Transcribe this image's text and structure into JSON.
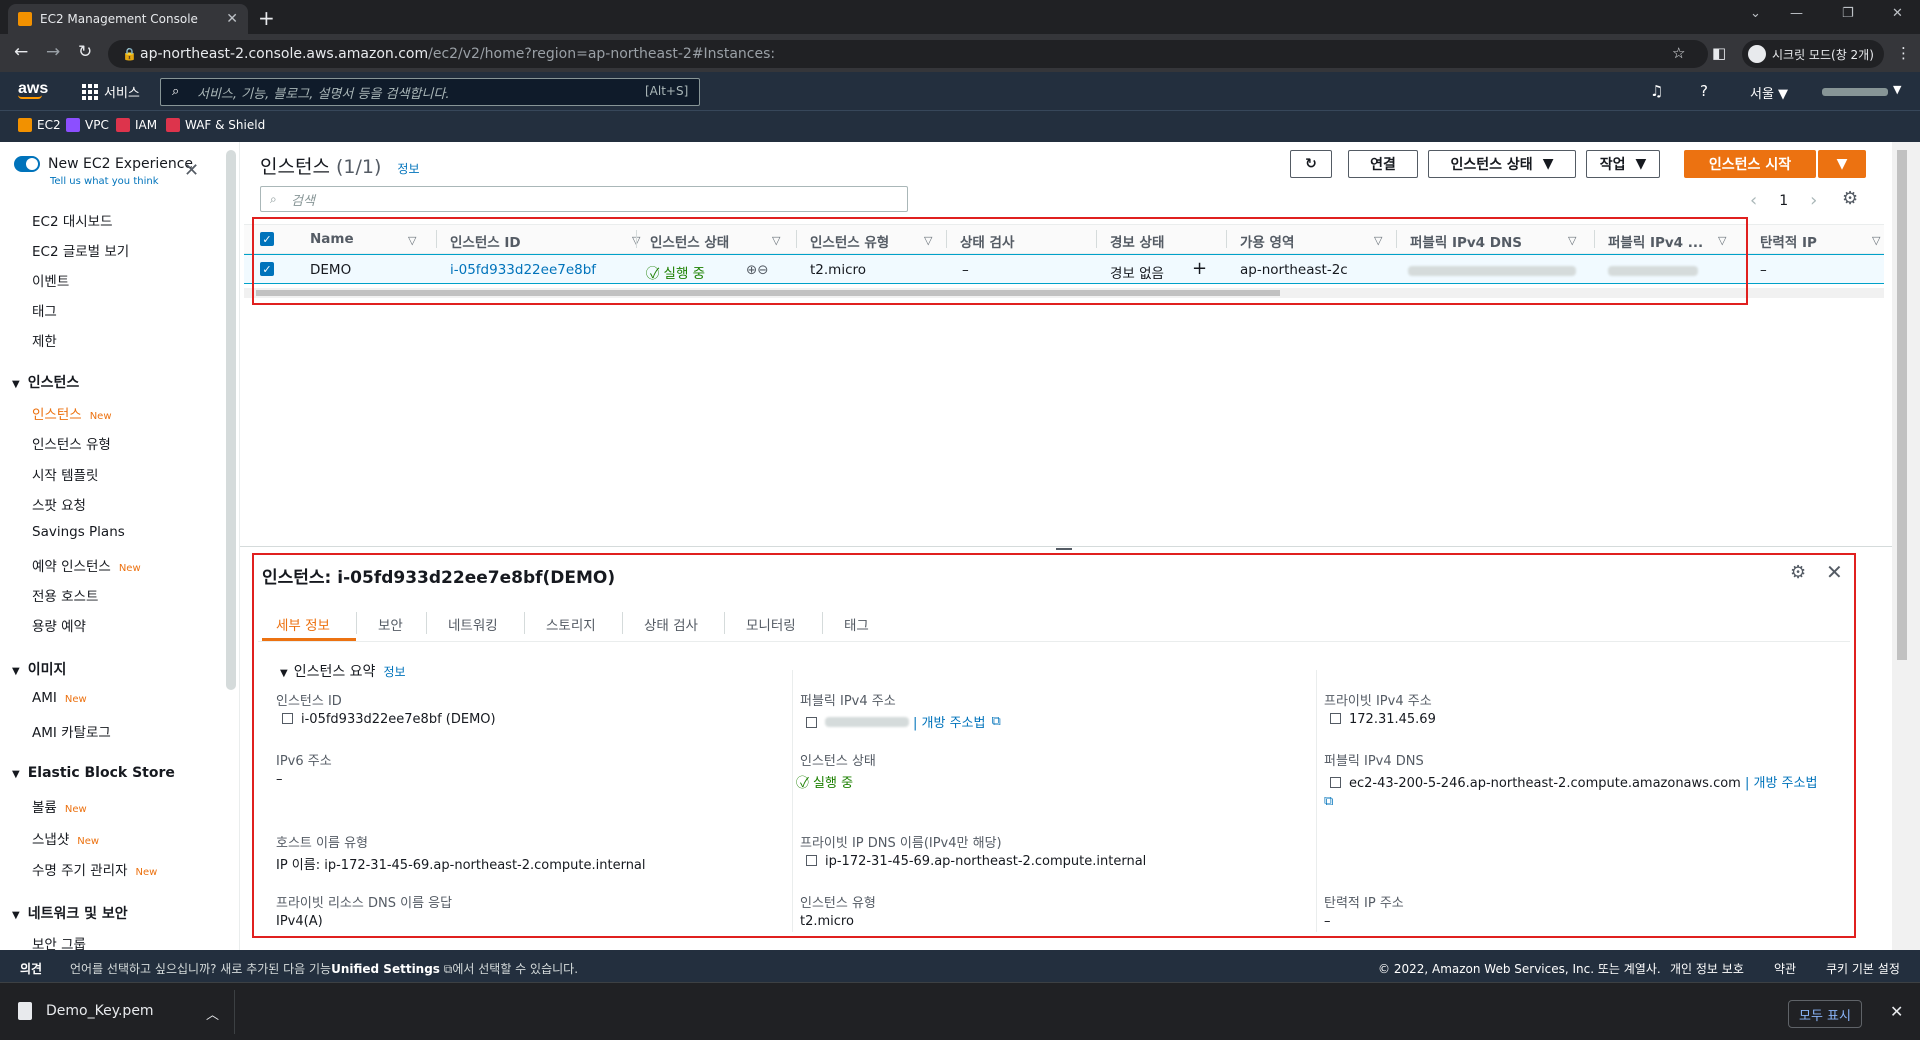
{
  "browser": {
    "tab_title": "EC2 Management Console",
    "url_host": "ap-northeast-2.console.aws.amazon.com",
    "url_path": "/ec2/v2/home?region=ap-northeast-2#Instances:",
    "incognito_label": "시크릿 모드(창 2개)"
  },
  "awsnav": {
    "logo": "aws",
    "services_label": "서비스",
    "search_placeholder": "서비스, 기능, 블로그, 설명서 등을 검색합니다.",
    "search_shortcut": "[Alt+S]",
    "region": "서울 ▼"
  },
  "favorites": [
    {
      "label": "EC2",
      "color": "#f29100"
    },
    {
      "label": "VPC",
      "color": "#8c4fff"
    },
    {
      "label": "IAM",
      "color": "#dd344c"
    },
    {
      "label": "WAF & Shield",
      "color": "#dd344c"
    }
  ],
  "sidebar": {
    "new_experience": "New EC2 Experience",
    "tell_us": "Tell us what you think",
    "top_items": [
      "EC2 대시보드",
      "EC2 글로벌 보기",
      "이벤트",
      "태그",
      "제한"
    ],
    "section_instances": "인스턴스",
    "instances_items": [
      {
        "label": "인스턴스",
        "badge": "New"
      },
      {
        "label": "인스턴스 유형",
        "badge": ""
      },
      {
        "label": "시작 템플릿",
        "badge": ""
      },
      {
        "label": "스팟 요청",
        "badge": ""
      },
      {
        "label": "Savings Plans",
        "badge": ""
      },
      {
        "label": "예약 인스턴스",
        "badge": "New"
      },
      {
        "label": "전용 호스트",
        "badge": ""
      },
      {
        "label": "용량 예약",
        "badge": ""
      }
    ],
    "section_images": "이미지",
    "images_items": [
      {
        "label": "AMI",
        "badge": "New"
      },
      {
        "label": "AMI 카탈로그",
        "badge": ""
      }
    ],
    "section_ebs": "Elastic Block Store",
    "ebs_items": [
      {
        "label": "볼륨",
        "badge": "New"
      },
      {
        "label": "스냅샷",
        "badge": "New"
      },
      {
        "label": "수명 주기 관리자",
        "badge": "New"
      }
    ],
    "section_network": "네트워크 및 보안",
    "network_items": [
      {
        "label": "보안 그룹",
        "badge": ""
      }
    ]
  },
  "main": {
    "title": "인스턴스",
    "count": "(1/1)",
    "info": "정보",
    "btn_connect": "연결",
    "btn_state": "인스턴스 상태",
    "btn_actions": "작업",
    "btn_launch": "인스턴스 시작",
    "filter_placeholder": "검색",
    "page": "1",
    "columns": [
      "Name",
      "인스턴스 ID",
      "인스턴스 상태",
      "인스턴스 유형",
      "상태 검사",
      "경보 상태",
      "가용 영역",
      "퍼블릭 IPv4 DNS",
      "퍼블릭 IPv4 ...",
      "탄력적 IP"
    ],
    "row": {
      "name": "DEMO",
      "instance_id": "i-05fd933d22ee7e8bf",
      "state": "실행 중",
      "type": "t2.micro",
      "status_check": "–",
      "alarm": "경보 없음",
      "az": "ap-northeast-2c",
      "elastic_ip": "–"
    }
  },
  "details": {
    "title": "인스턴스: i-05fd933d22ee7e8bf(DEMO)",
    "tabs": [
      "세부 정보",
      "보안",
      "네트워킹",
      "스토리지",
      "상태 검사",
      "모니터링",
      "태그"
    ],
    "summary": "인스턴스 요약",
    "info": "정보",
    "fields": {
      "instance_id_label": "인스턴스 ID",
      "instance_id": "i-05fd933d22ee7e8bf (DEMO)",
      "ipv6_label": "IPv6 주소",
      "ipv6": "–",
      "hostname_type_label": "호스트 이름 유형",
      "hostname_type": "IP 이름: ip-172-31-45-69.ap-northeast-2.compute.internal",
      "private_dns_resp_label": "프라이빗 리소스 DNS 이름 응답",
      "private_dns_resp": "IPv4(A)",
      "public_ipv4_label": "퍼블릭 IPv4 주소",
      "open_address": "| 개방 주소법",
      "state_label": "인스턴스 상태",
      "state": "실행 중",
      "private_ip_dns_label": "프라이빗 IP DNS 이름(IPv4만 해당)",
      "private_ip_dns": "ip-172-31-45-69.ap-northeast-2.compute.internal",
      "type_label": "인스턴스 유형",
      "type": "t2.micro",
      "private_ipv4_label": "프라이빗 IPv4 주소",
      "private_ipv4": "172.31.45.69",
      "public_dns_label": "퍼블릭 IPv4 DNS",
      "public_dns": "ec2-43-200-5-246.ap-northeast-2.compute.amazonaws.com",
      "public_dns_open": "| 개방 주소법",
      "elastic_ip_label": "탄력적 IP 주소",
      "elastic_ip": "–"
    }
  },
  "footer": {
    "feedback": "의견",
    "language_msg_1": "언어를 선택하고 싶으십니까? 새로 추가된 다음 기능",
    "unified_settings": "Unified Settings",
    "language_msg_2": "에서 선택할 수 있습니다.",
    "copyright": "© 2022, Amazon Web Services, Inc. 또는 계열사.",
    "privacy": "개인 정보 보호",
    "terms": "약관",
    "cookies": "쿠키 기본 설정"
  },
  "downloads": {
    "file": "Demo_Key.pem",
    "show_all": "모두 표시"
  }
}
